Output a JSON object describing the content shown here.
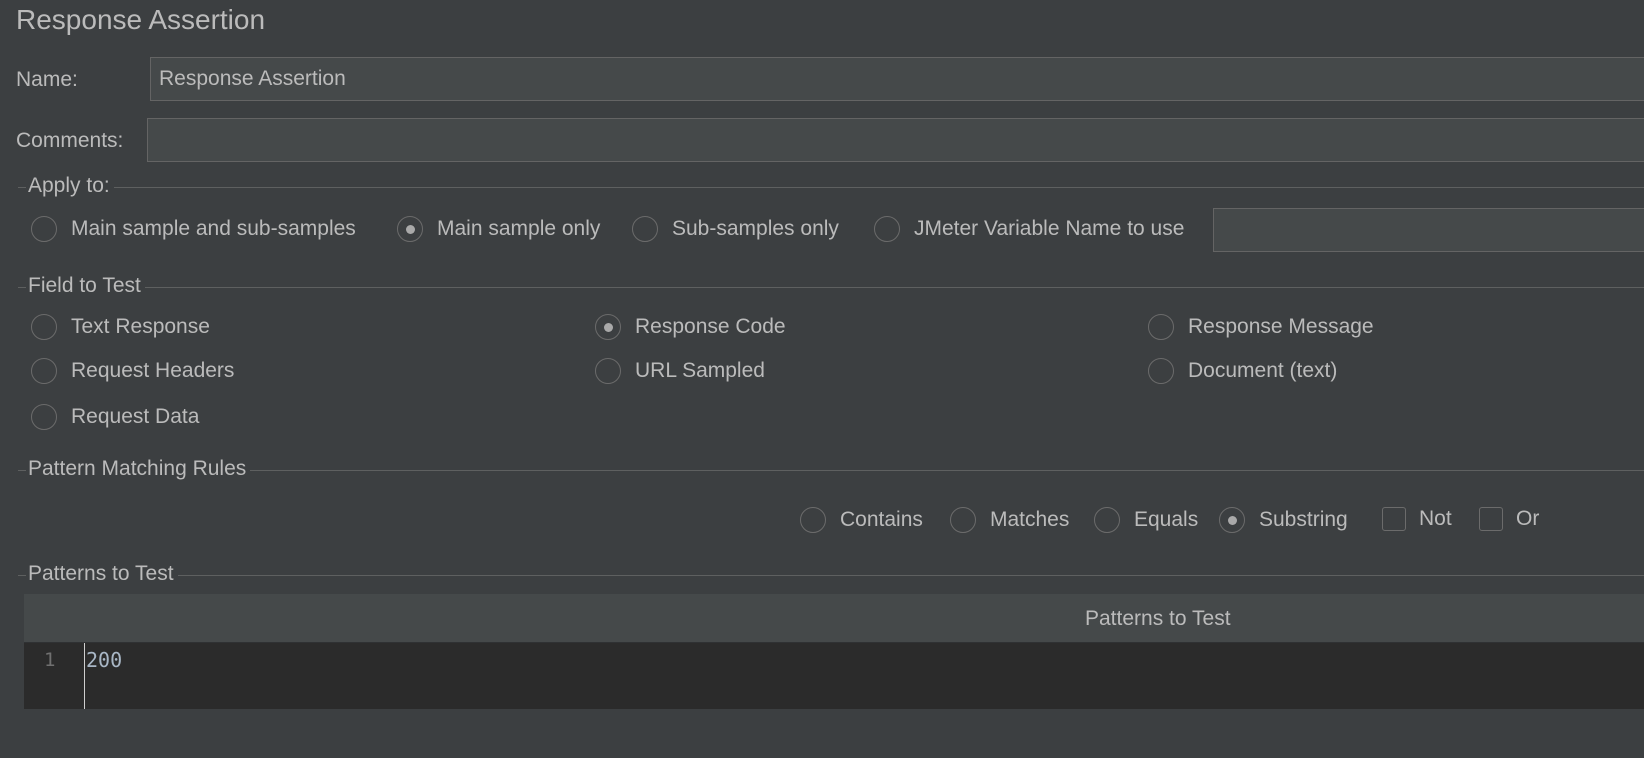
{
  "panel": {
    "title": "Response Assertion"
  },
  "name": {
    "label": "Name:",
    "value": "Response Assertion"
  },
  "comments": {
    "label": "Comments:",
    "value": ""
  },
  "apply_to": {
    "legend": "Apply to:",
    "options": [
      "Main sample and sub-samples",
      "Main sample only",
      "Sub-samples only",
      "JMeter Variable Name to use"
    ],
    "selected": "Main sample only",
    "variable_value": ""
  },
  "field_to_test": {
    "legend": "Field to Test",
    "options": [
      "Text Response",
      "Response Code",
      "Response Message",
      "Request Headers",
      "URL Sampled",
      "Document (text)",
      "Request Data"
    ],
    "selected": "Response Code"
  },
  "pattern_rules": {
    "legend": "Pattern Matching Rules",
    "options": [
      "Contains",
      "Matches",
      "Equals",
      "Substring"
    ],
    "selected": "Substring",
    "not_label": "Not",
    "not_checked": false,
    "or_label": "Or",
    "or_checked": false
  },
  "patterns": {
    "legend": "Patterns to Test",
    "column_header": "Patterns to Test",
    "rows": [
      {
        "line": "1",
        "value": "200"
      }
    ]
  }
}
